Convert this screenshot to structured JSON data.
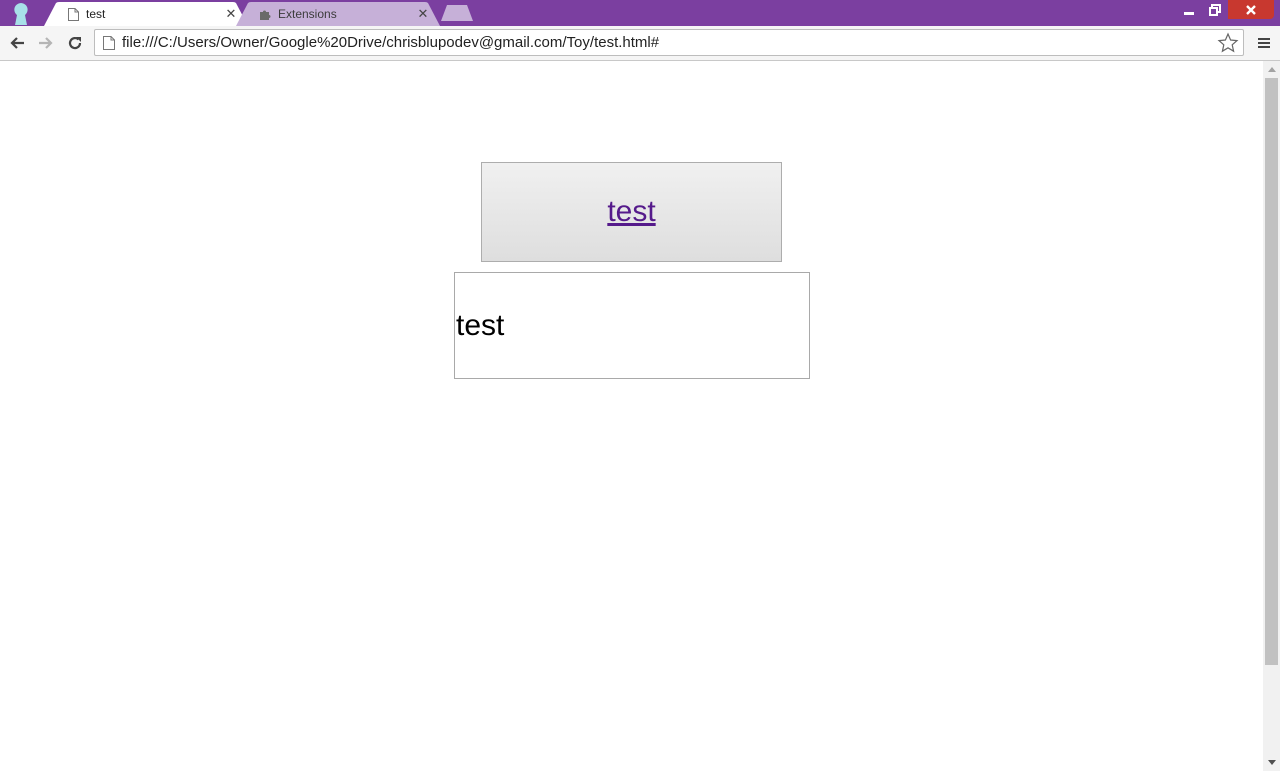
{
  "tabs": [
    {
      "title": "test",
      "icon": "page-icon",
      "active": true
    },
    {
      "title": "Extensions",
      "icon": "puzzle-icon",
      "active": false
    }
  ],
  "omnibox": {
    "url": "file:///C:/Users/Owner/Google%20Drive/chrisblupodev@gmail.com/Toy/test.html#"
  },
  "page": {
    "button_link_text": "test",
    "field_text": "test"
  },
  "colors": {
    "frame": "#7b3fa0",
    "close": "#c8382f",
    "visited_link": "#551a8b"
  }
}
